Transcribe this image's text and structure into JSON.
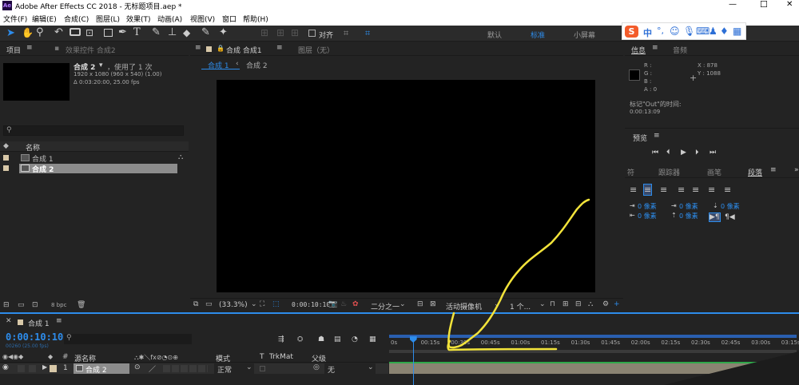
{
  "app": {
    "title": "Adobe After Effects CC 2018 - 无标题项目.aep *",
    "logo": "Ae",
    "window_buttons": [
      "—",
      "☐",
      "✕"
    ]
  },
  "menu": [
    "文件(F)",
    "编辑(E)",
    "合成(C)",
    "图层(L)",
    "效果(T)",
    "动画(A)",
    "视图(V)",
    "窗口",
    "帮助(H)"
  ],
  "toolbar": {
    "align_label": "对齐",
    "workspaces": [
      "默认",
      "标准",
      "小屏幕"
    ],
    "active_workspace": "标准"
  },
  "ime": {
    "label": "中"
  },
  "project_panel": {
    "tab_label": "项目",
    "effects_tab_label": "效果控件 合成2",
    "comp_name": "合成 2",
    "usage": "，使用了 1 次",
    "resolution": "1920 x 1080 (960 x 540) (1.00)",
    "duration": "Δ 0:03:20:00, 25.00 fps",
    "search_placeholder": "",
    "column_name": "名称",
    "items": [
      {
        "name": "合成 1",
        "selected": false
      },
      {
        "name": "合成 2",
        "selected": true
      }
    ],
    "bpc": "8 bpc"
  },
  "composition_panel": {
    "tab_label": "合成 合成1",
    "layer_tab_label": "图层（无）",
    "sub_tabs": [
      "合成 1",
      "合成 2"
    ],
    "zoom": "(33.3%)",
    "timecode": "0:00:10:10",
    "resolution": "二分之一",
    "camera": "活动摄像机",
    "views": "1 个..."
  },
  "info_panel": {
    "tab_label": "信息",
    "audio_tab_label": "音频",
    "r": "R :",
    "g": "G :",
    "b": "B :",
    "a": "A : 0",
    "x": "X : 878",
    "y": "Y : 1088",
    "note": "标记\"Out\"的时间:",
    "note_time": "0:00:13:09"
  },
  "preview_panel": {
    "tab_label": "预览"
  },
  "paragraph_panel": {
    "tabs": [
      "符",
      "跟踪器",
      "画笔",
      "段落"
    ],
    "active_tab": "段落",
    "px_labels": [
      "0 像素",
      "0 像素",
      "0 像素",
      "0 像素",
      "0 像素"
    ]
  },
  "timeline": {
    "tab_label": "合成 1",
    "timecode": "0:00:10:10",
    "timecode_sub": "00260 (25.00 fps)",
    "search_placeholder": "",
    "headers": {
      "source_name": "源名称",
      "mode": "模式",
      "t": "T",
      "trkmat": "TrkMat",
      "parent": "父级"
    },
    "layer": {
      "index": "1",
      "name": "合成 2",
      "mode": "正常",
      "parent": "无"
    },
    "ruler": [
      "0s",
      "00:15s",
      "00:30s",
      "00:45s",
      "01:00s",
      "01:15s",
      "01:30s",
      "01:45s",
      "02:00s",
      "02:15s",
      "02:30s",
      "02:45s",
      "03:00s",
      "03:15s"
    ],
    "playhead_fraction": 0.052
  },
  "colors": {
    "accent": "#2d8ceb",
    "annotation": "#f2e33a",
    "layer_bar": "#8a8372",
    "work_area": "#2a5fb0"
  }
}
